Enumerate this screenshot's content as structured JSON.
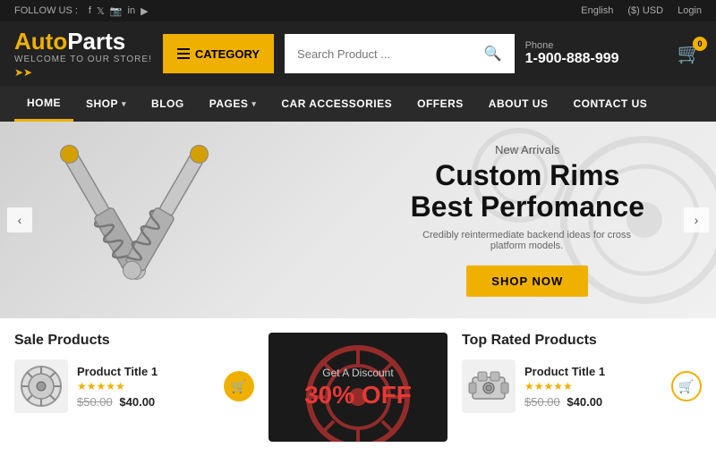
{
  "topbar": {
    "follow_text": "FOLLOW US :",
    "language": "English",
    "currency": "($) USD",
    "login": "Login"
  },
  "header": {
    "logo_auto": "Auto",
    "logo_parts": "Parts",
    "logo_sub": "WELCOME TO OUR STORE!",
    "category_label": "CATEGORY",
    "search_placeholder": "Search Product ...",
    "phone_label": "Phone",
    "phone_number": "1-900-888-999",
    "cart_count": "0"
  },
  "nav": {
    "items": [
      {
        "label": "HOME",
        "active": true,
        "has_arrow": false
      },
      {
        "label": "SHOP",
        "active": false,
        "has_arrow": true
      },
      {
        "label": "BLOG",
        "active": false,
        "has_arrow": false
      },
      {
        "label": "PAGES",
        "active": false,
        "has_arrow": true
      },
      {
        "label": "CAR ACCESSORIES",
        "active": false,
        "has_arrow": false
      },
      {
        "label": "OFFERS",
        "active": false,
        "has_arrow": false
      },
      {
        "label": "ABOUT US",
        "active": false,
        "has_arrow": false
      },
      {
        "label": "CONTACT US",
        "active": false,
        "has_arrow": false
      }
    ]
  },
  "hero": {
    "subtitle": "New Arrivals",
    "title_line1": "Custom Rims",
    "title_line2": "Best Perfomance",
    "description": "Credibly reintermediate backend ideas for cross platform models.",
    "cta_label": "SHOP NOW"
  },
  "sale_products": {
    "title": "Sale Products",
    "items": [
      {
        "name": "Product Title 1",
        "stars": "★★★★★",
        "price_old": "$50.00",
        "price_new": "$40.00"
      }
    ]
  },
  "promo": {
    "label": "Get A Discount",
    "discount": "30% OFF"
  },
  "top_rated": {
    "title": "Top Rated Products",
    "items": [
      {
        "name": "Product Title 1",
        "stars": "★★★★★",
        "price_old": "$50.00",
        "price_new": "$40.00"
      }
    ]
  }
}
